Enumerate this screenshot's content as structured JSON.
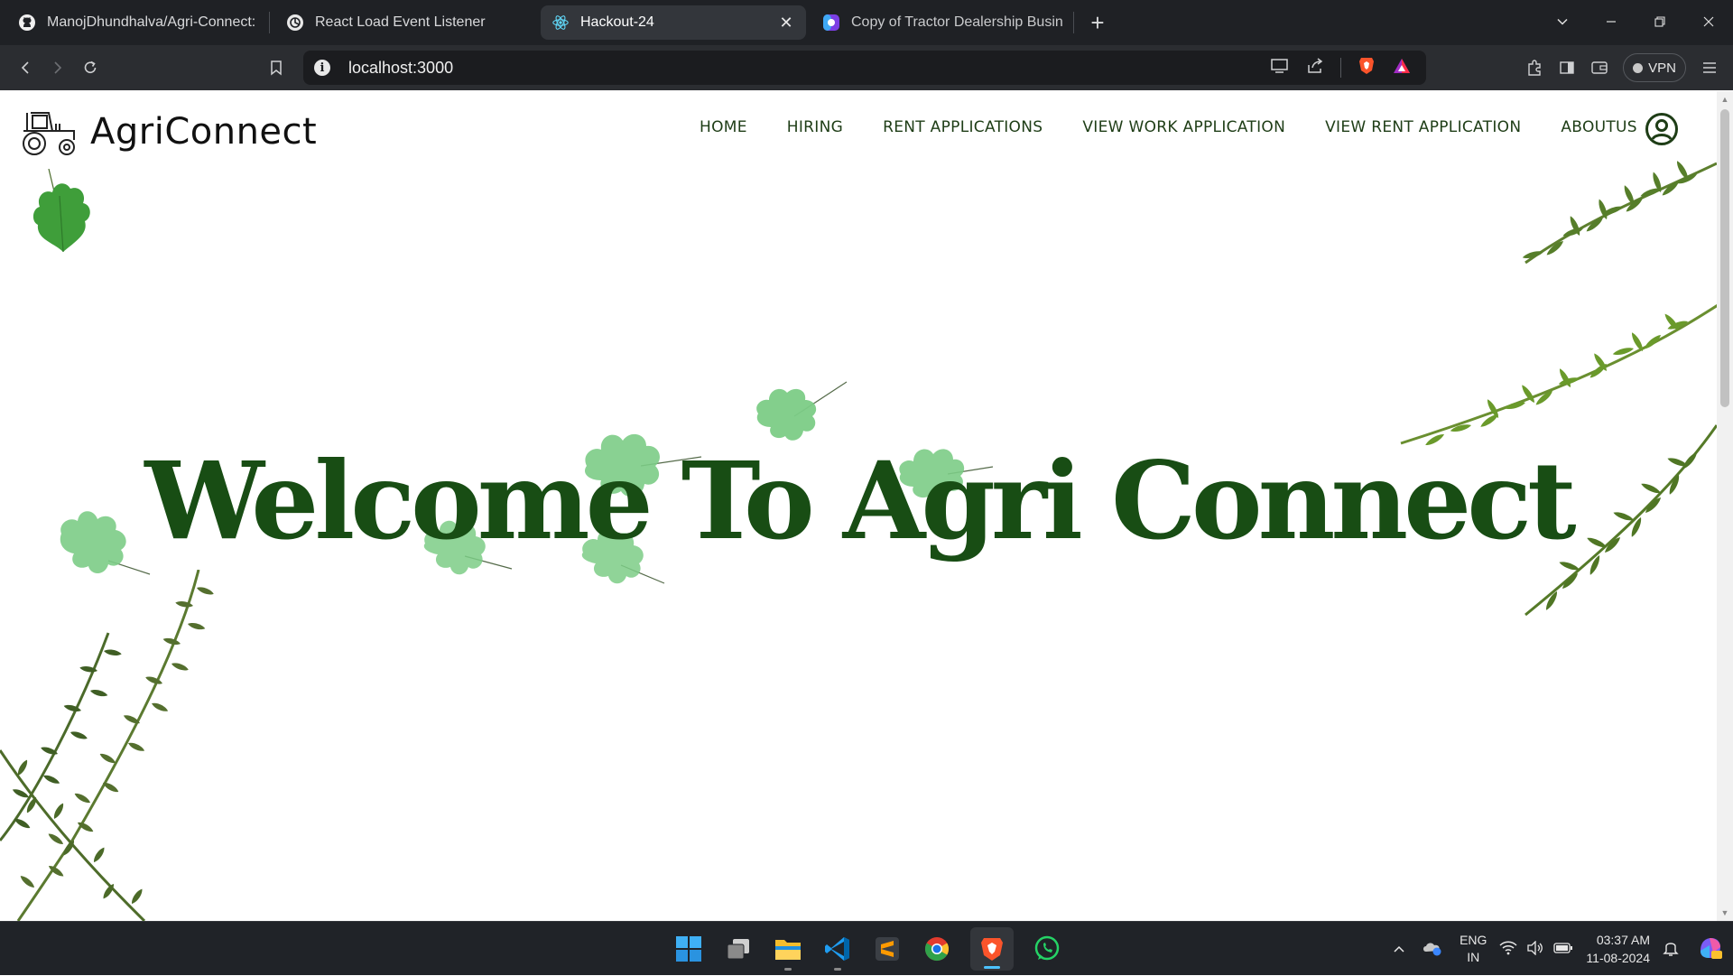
{
  "browser": {
    "tabs": [
      {
        "title": "ManojDhundhalva/Agri-Connect: Ha",
        "icon": "github-icon",
        "active": false
      },
      {
        "title": "React Load Event Listener",
        "icon": "openai-icon",
        "active": false
      },
      {
        "title": "Hackout-24",
        "icon": "react-icon",
        "active": true
      },
      {
        "title": "Copy of Tractor Dealership Business",
        "icon": "canva-icon",
        "active": false
      }
    ],
    "close_glyph": "✕",
    "new_tab_glyph": "+",
    "url": "localhost:3000",
    "vpn_label": "VPN"
  },
  "site": {
    "brand": "AgriConnect",
    "nav": [
      "HOME",
      "HIRING",
      "RENT APPLICATIONS",
      "VIEW WORK APPLICATION",
      "VIEW RENT APPLICATION",
      "ABOUTUS"
    ],
    "hero_title": "Welcome To Agri Connect",
    "colors": {
      "nav_text": "#1e3d16",
      "hero_text": "#184d14",
      "leaf_light": "#7ccc86",
      "leaf_dark": "#3f9e3a",
      "fern": "#4f7a24"
    }
  },
  "taskbar": {
    "apps": [
      "windows-start-icon",
      "task-view-icon",
      "file-explorer-icon",
      "vscode-icon",
      "sublime-text-icon",
      "chrome-icon",
      "brave-icon",
      "whatsapp-icon"
    ],
    "lang_line1": "ENG",
    "lang_line2": "IN",
    "time": "03:37 AM",
    "date": "11-08-2024"
  }
}
